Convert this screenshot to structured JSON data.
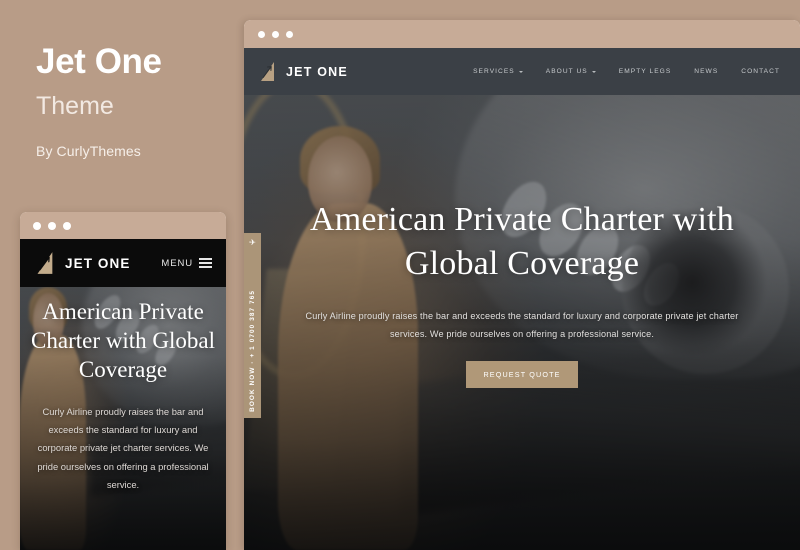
{
  "promo": {
    "title": "Jet One",
    "subtitle": "Theme",
    "author": "By CurlyThemes"
  },
  "colors": {
    "page_background": "#b89c87",
    "chrome_bar": "#c7ab97",
    "accent_tan": "#b09878",
    "nav_dark": "#3b4046",
    "mobile_nav_dark": "#0b0b0b",
    "booknow_tab": "#ab9578"
  },
  "desktop": {
    "chrome": {
      "dots": [
        "dot-red",
        "dot-yellow",
        "dot-green"
      ]
    },
    "brand": {
      "logo_icon": "jet-tail-arrow-logo-icon",
      "name": "JET ONE"
    },
    "nav": [
      {
        "label": "SERVICES",
        "has_dropdown": true
      },
      {
        "label": "ABOUT US",
        "has_dropdown": true
      },
      {
        "label": "EMPTY LEGS",
        "has_dropdown": false
      },
      {
        "label": "NEWS",
        "has_dropdown": false
      },
      {
        "label": "CONTACT",
        "has_dropdown": false
      }
    ],
    "booknow_tab": {
      "icon": "airplane-icon",
      "text": "BOOK NOW  ·  + 1 0700 387 765"
    },
    "hero": {
      "heading": "American Private Charter with Global Coverage",
      "paragraph": "Curly Airline proudly raises the bar and exceeds the standard for luxury and corporate private jet charter services. We pride ourselves on offering a professional service.",
      "cta_label": "REQUEST QUOTE",
      "background_image": "woman-in-camel-coat-boarding-private-jet"
    }
  },
  "mobile": {
    "chrome": {
      "dots": [
        "dot-red",
        "dot-yellow",
        "dot-green"
      ]
    },
    "brand": {
      "logo_icon": "jet-tail-arrow-logo-icon",
      "name": "JET ONE"
    },
    "menu": {
      "label": "MENU",
      "icon": "hamburger-menu-icon"
    },
    "hero": {
      "heading": "American Private Charter with Global Coverage",
      "paragraph": "Curly Airline proudly raises the bar and exceeds the standard for luxury and corporate private jet charter services. We pride ourselves on offering a professional service.",
      "background_image": "woman-in-camel-coat-boarding-private-jet"
    }
  }
}
